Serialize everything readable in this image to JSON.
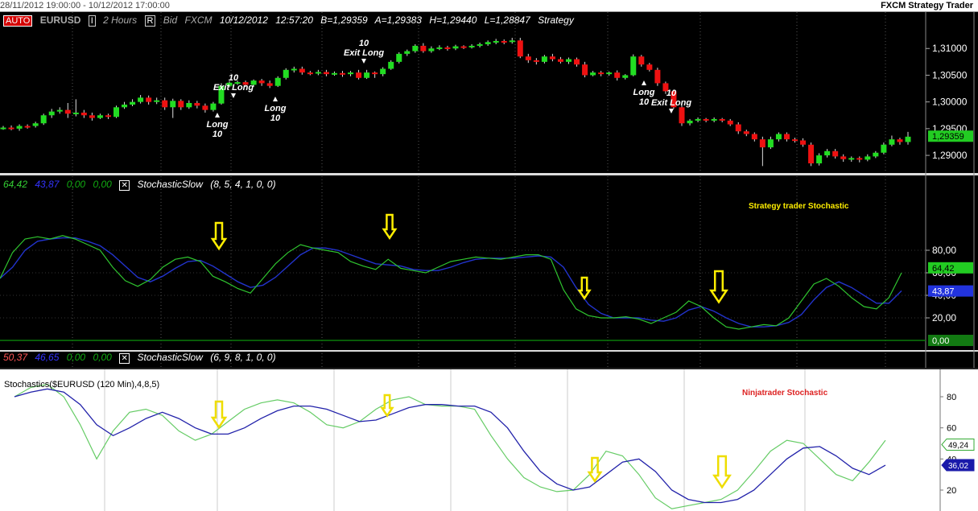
{
  "top_bar": {
    "range": "28/11/2012 19:00:00 - 10/12/2012 17:00:00",
    "app_title": "FXCM Strategy Trader"
  },
  "price_panel": {
    "mode_button": "AUTO",
    "symbol": "EURUSD",
    "interval_button": "I",
    "interval": "2 Hours",
    "r_button": "R",
    "quote_type": "Bid",
    "broker": "FXCM",
    "date": "10/12/2012",
    "time": "12:57:20",
    "bid": "B=1,29359",
    "ask": "A=1,29383",
    "high": "H=1,29440",
    "low": "L=1,28847",
    "strategy": "Strategy",
    "current_price_label": "1,29359",
    "axis_ticks": [
      "1,31000",
      "1,30500",
      "1,30000",
      "1,29500",
      "1,29000"
    ],
    "annotations": [
      {
        "label": "10",
        "text": "Exit Long"
      },
      {
        "label": "Long",
        "text": "10"
      },
      {
        "label": "Long",
        "text": "10"
      },
      {
        "label": "10",
        "text": "Exit Long"
      },
      {
        "label": "Long",
        "text": "10"
      },
      {
        "label": "10",
        "text": "Exit Long"
      }
    ]
  },
  "stoch_panel_1": {
    "values": {
      "k": "64,42",
      "d": "43,87",
      "v3": "0,00",
      "v4": "0,00"
    },
    "indicator": "StochasticSlow",
    "params": "(8, 5, 4, 1, 0, 0)",
    "caption": "Strategy trader Stochastic",
    "axis_ticks": [
      "80,00",
      "60,00",
      "40,00",
      "20,00"
    ],
    "k_label": "64,42",
    "d_label": "43,87",
    "zero_label": "0,00"
  },
  "stoch_panel_2": {
    "values": {
      "k": "50,37",
      "d": "46,65",
      "v3": "0,00",
      "v4": "0,00"
    },
    "indicator": "StochasticSlow",
    "params": "(6, 9, 8, 1, 0, 0)"
  },
  "ninja_panel": {
    "title": "Stochastics($EURUSD (120 Min),4,8,5)",
    "caption": "Ninjatrader Stochastic",
    "axis_ticks": [
      "80",
      "60",
      "40",
      "20"
    ],
    "k_label": "49,24",
    "d_label": "36,02"
  },
  "colors": {
    "k_line": "#2fc52f",
    "d_line": "#2233cc",
    "up_candle": "#22dd22",
    "down_candle": "#ee1111",
    "arrow": "#ffee00"
  },
  "chart_data": {
    "type": "line",
    "price": {
      "candles": [
        [
          1.295,
          1.2952,
          1.2955,
          1.2948
        ],
        [
          1.2952,
          1.295,
          1.2956,
          1.2947
        ],
        [
          1.295,
          1.2955,
          1.2958,
          1.2946
        ],
        [
          1.2955,
          1.2953,
          1.2958,
          1.295
        ],
        [
          1.2955,
          1.296,
          1.2963,
          1.2952
        ],
        [
          1.296,
          1.2975,
          1.2978,
          1.2957
        ],
        [
          1.2975,
          1.2982,
          1.2987,
          1.297
        ],
        [
          1.2982,
          1.2985,
          1.299,
          1.2978
        ],
        [
          1.2985,
          1.2978,
          1.2998,
          1.297
        ],
        [
          1.2978,
          1.298,
          1.3005,
          1.2973
        ],
        [
          1.298,
          1.2975,
          1.2985,
          1.297
        ],
        [
          1.2975,
          1.297,
          1.298,
          1.2965
        ],
        [
          1.297,
          1.2975,
          1.2978,
          1.2968
        ],
        [
          1.2975,
          1.2972,
          1.2978,
          1.2968
        ],
        [
          1.2972,
          1.299,
          1.2993,
          1.297
        ],
        [
          1.299,
          1.2995,
          1.3,
          1.2987
        ],
        [
          1.2995,
          1.3,
          1.3005,
          1.2992
        ],
        [
          1.3,
          1.3008,
          1.3013,
          1.2997
        ],
        [
          1.3008,
          1.3,
          1.3012,
          1.2995
        ],
        [
          1.3,
          1.3003,
          1.3008,
          1.2996
        ],
        [
          1.3003,
          1.299,
          1.3008,
          1.2985
        ],
        [
          1.299,
          1.3002,
          1.3006,
          1.297
        ],
        [
          1.3002,
          1.299,
          1.3005,
          1.2985
        ],
        [
          1.299,
          1.2998,
          1.3003,
          1.2987
        ],
        [
          1.2998,
          1.2993,
          1.3002,
          1.2988
        ],
        [
          1.2993,
          1.2985,
          1.2997,
          1.298
        ],
        [
          1.2985,
          1.2997,
          1.3,
          1.2982
        ],
        [
          1.2997,
          1.303,
          1.3035,
          1.2995
        ],
        [
          1.303,
          1.3036,
          1.3039,
          1.3027
        ],
        [
          1.3036,
          1.3037,
          1.304,
          1.3032
        ],
        [
          1.3037,
          1.3032,
          1.304,
          1.3028
        ],
        [
          1.3032,
          1.304,
          1.3042,
          1.3028
        ],
        [
          1.304,
          1.3035,
          1.3043,
          1.303
        ],
        [
          1.3035,
          1.303,
          1.304,
          1.3026
        ],
        [
          1.303,
          1.3045,
          1.3048,
          1.3028
        ],
        [
          1.3045,
          1.306,
          1.3063,
          1.3042
        ],
        [
          1.306,
          1.3062,
          1.3066,
          1.3055
        ],
        [
          1.3062,
          1.3055,
          1.3066,
          1.3051
        ],
        [
          1.3055,
          1.3054,
          1.3058,
          1.305
        ],
        [
          1.3054,
          1.3056,
          1.306,
          1.305
        ],
        [
          1.3056,
          1.3052,
          1.306,
          1.3048
        ],
        [
          1.3052,
          1.3054,
          1.3057,
          1.3049
        ],
        [
          1.3054,
          1.3052,
          1.3058,
          1.3047
        ],
        [
          1.3052,
          1.3055,
          1.3058,
          1.3048
        ],
        [
          1.3055,
          1.3045,
          1.306,
          1.3042
        ],
        [
          1.3045,
          1.3055,
          1.306,
          1.3043
        ],
        [
          1.3055,
          1.3052,
          1.3057,
          1.3045
        ],
        [
          1.3052,
          1.3062,
          1.3065,
          1.3048
        ],
        [
          1.3062,
          1.3075,
          1.3078,
          1.306
        ],
        [
          1.3075,
          1.309,
          1.3093,
          1.3072
        ],
        [
          1.309,
          1.3095,
          1.3098,
          1.3086
        ],
        [
          1.3095,
          1.3105,
          1.3108,
          1.3092
        ],
        [
          1.3105,
          1.3095,
          1.311,
          1.3092
        ],
        [
          1.3095,
          1.31,
          1.3104,
          1.3092
        ],
        [
          1.31,
          1.3102,
          1.3106,
          1.3097
        ],
        [
          1.3102,
          1.31,
          1.3105,
          1.3096
        ],
        [
          1.31,
          1.3104,
          1.3107,
          1.3097
        ],
        [
          1.3104,
          1.3102,
          1.3106,
          1.3099
        ],
        [
          1.3102,
          1.3105,
          1.3108,
          1.31
        ],
        [
          1.3105,
          1.3108,
          1.3111,
          1.3102
        ],
        [
          1.3108,
          1.3112,
          1.3115,
          1.3105
        ],
        [
          1.3112,
          1.3114,
          1.3118,
          1.3108
        ],
        [
          1.3114,
          1.3112,
          1.3117,
          1.3108
        ],
        [
          1.3112,
          1.3115,
          1.312,
          1.3109
        ],
        [
          1.3115,
          1.3085,
          1.312,
          1.3082
        ],
        [
          1.3085,
          1.3078,
          1.309,
          1.3073
        ],
        [
          1.3078,
          1.3075,
          1.3082,
          1.307
        ],
        [
          1.3075,
          1.3085,
          1.3088,
          1.3072
        ],
        [
          1.3085,
          1.308,
          1.309,
          1.3076
        ],
        [
          1.308,
          1.3075,
          1.3084,
          1.3072
        ],
        [
          1.3075,
          1.308,
          1.3083,
          1.3071
        ],
        [
          1.308,
          1.307,
          1.3083,
          1.3066
        ],
        [
          1.307,
          1.305,
          1.3075,
          1.3046
        ],
        [
          1.305,
          1.3055,
          1.3058,
          1.3048
        ],
        [
          1.3055,
          1.3052,
          1.3058,
          1.3048
        ],
        [
          1.3052,
          1.3055,
          1.3057,
          1.3049
        ],
        [
          1.3055,
          1.3045,
          1.3059,
          1.304
        ],
        [
          1.3045,
          1.305,
          1.3052,
          1.3042
        ],
        [
          1.305,
          1.3085,
          1.3089,
          1.3048
        ],
        [
          1.3085,
          1.307,
          1.3088,
          1.3066
        ],
        [
          1.307,
          1.306,
          1.3073,
          1.3057
        ],
        [
          1.306,
          1.3035,
          1.3064,
          1.303
        ],
        [
          1.3035,
          1.302,
          1.3038,
          1.3015
        ],
        [
          1.302,
          1.299,
          1.3023,
          1.2987
        ],
        [
          1.299,
          1.296,
          1.2994,
          1.2955
        ],
        [
          1.296,
          1.2965,
          1.2968,
          1.2956
        ],
        [
          1.2965,
          1.2968,
          1.2971,
          1.2962
        ],
        [
          1.2968,
          1.2965,
          1.297,
          1.2962
        ],
        [
          1.2965,
          1.2968,
          1.2971,
          1.2962
        ],
        [
          1.2968,
          1.2965,
          1.297,
          1.2962
        ],
        [
          1.2965,
          1.2958,
          1.2968,
          1.2955
        ],
        [
          1.2958,
          1.2945,
          1.2962,
          1.294
        ],
        [
          1.2945,
          1.294,
          1.2948,
          1.2936
        ],
        [
          1.294,
          1.293,
          1.2943,
          1.2926
        ],
        [
          1.293,
          1.2915,
          1.2935,
          1.288
        ],
        [
          1.2915,
          1.293,
          1.2935,
          1.2912
        ],
        [
          1.293,
          1.294,
          1.2943,
          1.2926
        ],
        [
          1.294,
          1.293,
          1.2943,
          1.2926
        ],
        [
          1.293,
          1.2928,
          1.2933,
          1.2924
        ],
        [
          1.2928,
          1.292,
          1.2932,
          1.2916
        ],
        [
          1.292,
          1.2885,
          1.2924,
          1.288
        ],
        [
          1.2885,
          1.29,
          1.2904,
          1.2881
        ],
        [
          1.29,
          1.2908,
          1.2912,
          1.2896
        ],
        [
          1.2908,
          1.2898,
          1.2912,
          1.2894
        ],
        [
          1.2898,
          1.2893,
          1.2902,
          1.2888
        ],
        [
          1.2893,
          1.2895,
          1.2898,
          1.2888
        ],
        [
          1.2895,
          1.2892,
          1.2898,
          1.2887
        ],
        [
          1.2892,
          1.2898,
          1.2902,
          1.2889
        ],
        [
          1.2898,
          1.2905,
          1.2908,
          1.2895
        ],
        [
          1.2905,
          1.292,
          1.2924,
          1.2902
        ],
        [
          1.292,
          1.293,
          1.2937,
          1.2917
        ],
        [
          1.293,
          1.2925,
          1.2933,
          1.292
        ],
        [
          1.2925,
          1.2935,
          1.2944,
          1.292
        ]
      ],
      "ylim": [
        1.287,
        1.3135
      ]
    },
    "stochastic_strategy_trader": {
      "k": [
        55,
        78,
        90,
        92,
        90,
        93,
        90,
        85,
        80,
        65,
        53,
        48,
        54,
        65,
        72,
        74,
        70,
        57,
        52,
        46,
        42,
        55,
        68,
        78,
        85,
        82,
        80,
        78,
        70,
        66,
        63,
        72,
        64,
        62,
        60,
        65,
        70,
        72,
        74,
        73,
        72,
        74,
        76,
        76,
        72,
        45,
        28,
        22,
        20,
        20,
        21,
        19,
        15,
        20,
        25,
        35,
        30,
        20,
        12,
        10,
        12,
        14,
        13,
        20,
        35,
        50,
        55,
        48,
        38,
        30,
        28,
        38,
        60
      ],
      "d": [
        55,
        65,
        80,
        88,
        90,
        91,
        91,
        88,
        84,
        76,
        66,
        56,
        52,
        57,
        64,
        70,
        71,
        66,
        59,
        52,
        47,
        49,
        56,
        66,
        76,
        82,
        82,
        80,
        76,
        72,
        68,
        67,
        66,
        63,
        62,
        62,
        65,
        69,
        72,
        73,
        73,
        73,
        74,
        75,
        74,
        65,
        47,
        32,
        24,
        20,
        20,
        20,
        18,
        17,
        20,
        27,
        30,
        26,
        20,
        15,
        12,
        12,
        13,
        16,
        23,
        36,
        47,
        52,
        47,
        40,
        33,
        33,
        44
      ]
    },
    "stochastic_ninjatrader": {
      "k": [
        80,
        86,
        88,
        80,
        62,
        40,
        58,
        70,
        72,
        68,
        58,
        52,
        56,
        64,
        72,
        76,
        78,
        76,
        70,
        62,
        60,
        64,
        72,
        78,
        80,
        75,
        74,
        74,
        72,
        55,
        40,
        28,
        22,
        19,
        20,
        30,
        45,
        42,
        30,
        15,
        8,
        10,
        12,
        14,
        20,
        32,
        45,
        52,
        50,
        40,
        30,
        26,
        38,
        52
      ],
      "d": [
        80,
        83,
        85,
        83,
        75,
        62,
        55,
        60,
        66,
        70,
        66,
        60,
        56,
        56,
        60,
        66,
        71,
        74,
        74,
        72,
        68,
        64,
        65,
        69,
        73,
        75,
        75,
        74,
        74,
        70,
        60,
        45,
        32,
        24,
        20,
        22,
        30,
        38,
        40,
        32,
        20,
        14,
        12,
        12,
        14,
        20,
        30,
        40,
        47,
        48,
        42,
        34,
        30,
        36
      ],
      "ylim": [
        10,
        90
      ]
    }
  }
}
